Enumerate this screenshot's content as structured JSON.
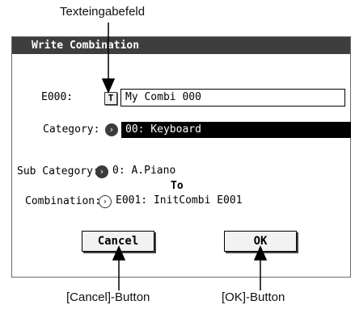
{
  "callouts": {
    "text_field": "Texteingabefeld",
    "cancel": "[Cancel]-Button",
    "ok": "[OK]-Button"
  },
  "dialog": {
    "title": "Write Combination",
    "name_label": "E000:",
    "text_edit_glyph": "T",
    "name_value": "My Combi 000",
    "category_label": "Category:",
    "category_value": "00: Keyboard",
    "subcategory_label": "Sub Category:",
    "subcategory_value": "0: A.Piano",
    "to_label": "To",
    "combination_label": "Combination:",
    "combination_value": "E001: InitCombi E001",
    "cancel_label": "Cancel",
    "ok_label": "OK"
  },
  "colors": {
    "titlebar": "#3e3e3e",
    "selected_field_bg": "#000000",
    "dialog_border": "#6a6a6a"
  },
  "icons": {
    "popup": "chevron-right-circle-icon",
    "text_edit": "text-edit-icon"
  }
}
